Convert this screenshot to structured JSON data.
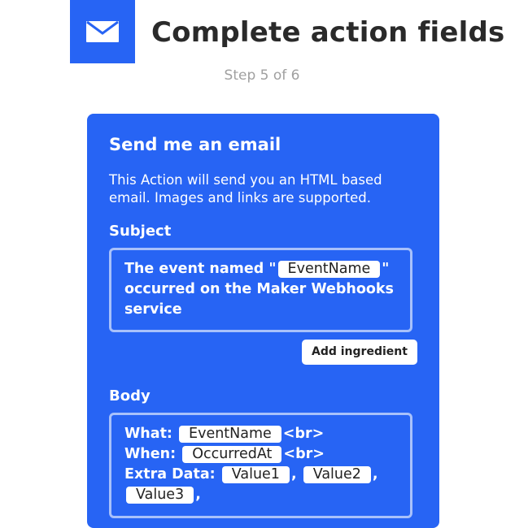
{
  "header": {
    "icon": "envelope-icon",
    "title": "Complete action fields",
    "step": "Step 5 of 6"
  },
  "colors": {
    "accent": "#2764f4",
    "title_text": "#2a2a2a",
    "step_text": "#a0a0a0"
  },
  "card": {
    "title": "Send me an email",
    "description": "This Action will send you an HTML based email. Images and links are supported.",
    "subject": {
      "label": "Subject",
      "text_before": "The event named \"",
      "ingredient": "EventName",
      "text_after": "\" occurred on the Maker Webhooks service"
    },
    "add_ingredient_label": "Add ingredient",
    "body": {
      "label": "Body",
      "what_label": "What:",
      "what_ingredient": "EventName",
      "what_suffix": "<br>",
      "when_label": "When:",
      "when_ingredient": "OccurredAt",
      "when_suffix": "<br>",
      "extra_label": "Extra Data:",
      "value1": "Value1",
      "value2": "Value2",
      "value3": "Value3",
      "separator": ","
    }
  }
}
